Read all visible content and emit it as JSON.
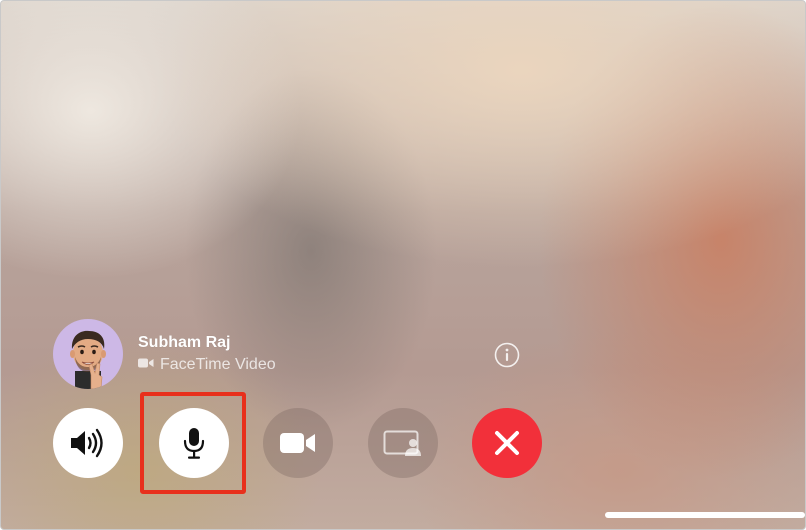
{
  "caller": {
    "name": "Subham Raj",
    "call_type": "FaceTime Video",
    "avatar": "memoji-peace-sign"
  },
  "controls": [
    {
      "name": "speaker-button",
      "icon": "speaker-volume-icon",
      "state": "on"
    },
    {
      "name": "mute-button",
      "icon": "microphone-icon",
      "state": "on",
      "highlighted": true
    },
    {
      "name": "camera-button",
      "icon": "video-camera-icon",
      "state": "off"
    },
    {
      "name": "share-screen-button",
      "icon": "share-screen-icon",
      "state": "off"
    },
    {
      "name": "end-call-button",
      "icon": "close-icon",
      "color": "#f2303a"
    }
  ],
  "info_button": {
    "icon": "info-icon"
  },
  "highlight_color": "#e8301c"
}
